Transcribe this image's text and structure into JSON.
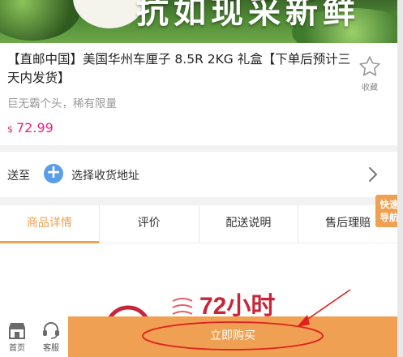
{
  "banner": {
    "slogan": "抗如现采新鲜"
  },
  "product": {
    "title": "【直邮中国】美国华州车厘子 8.5R 2KG 礼盒【下单后预计三天内发货】",
    "subtitle": "巨无霸个头，稀有限量",
    "price_currency": "$",
    "price_value": "72.99",
    "favorite_label": "收藏"
  },
  "address": {
    "send_to_label": "送至",
    "choose_address_label": "选择收货地址"
  },
  "tabs": [
    {
      "label": "商品详情",
      "active": true
    },
    {
      "label": "评价",
      "active": false
    },
    {
      "label": "配送说明",
      "active": false
    },
    {
      "label": "售后理赔",
      "active": false
    }
  ],
  "quick_nav": {
    "line1": "快速",
    "line2": "导航"
  },
  "promo": {
    "text": "72小时"
  },
  "bottom_bar": {
    "home_label": "首页",
    "service_label": "客服",
    "buy_label": "立即购买"
  },
  "colors": {
    "accent": "#f0a052",
    "price": "#e6267d",
    "address_plus": "#5b9ee8",
    "annotation": "#e02020"
  }
}
